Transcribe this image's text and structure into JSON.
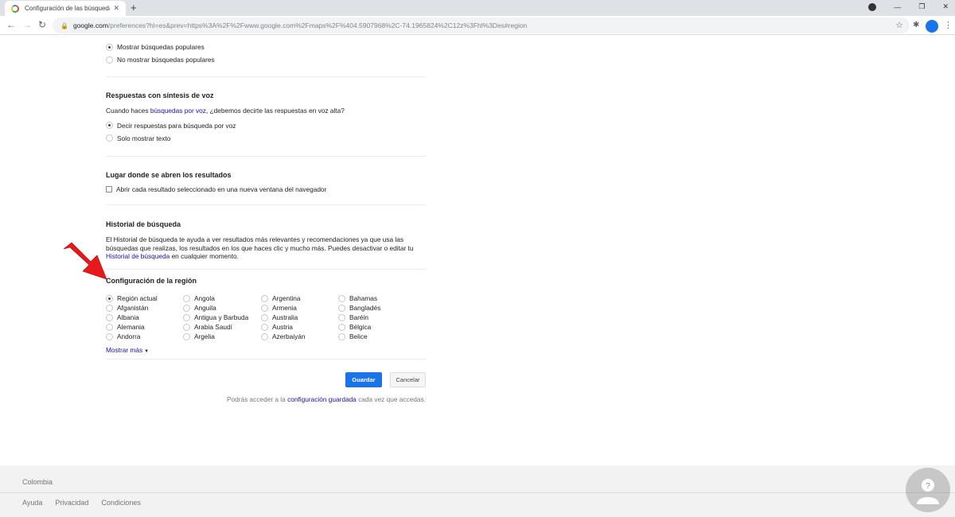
{
  "browser": {
    "tab_title": "Configuración de las búsquedas",
    "url_host": "google.com",
    "url_path": "/preferences?hl=es&prev=https%3A%2F%2Fwww.google.com%2Fmaps%2F%404.5907968%2C-74.1965824%2C12z%3Fhl%3Des#region"
  },
  "popular": {
    "options": [
      "Mostrar búsquedas populares",
      "No mostrar búsquedas populares"
    ],
    "selected_index": 0
  },
  "voice": {
    "title": "Respuestas con síntesis de voz",
    "question_prefix": "Cuando haces ",
    "question_link": "búsquedas por voz",
    "question_suffix": ", ¿debemos decirte las respuestas en voz alta?",
    "options": [
      "Decir respuestas para búsqueda por voz",
      "Solo mostrar texto"
    ],
    "selected_index": 0
  },
  "results_location": {
    "title": "Lugar donde se abren los resultados",
    "checkbox_label": "Abrir cada resultado seleccionado en una nueva ventana del navegador",
    "checked": false
  },
  "history": {
    "title": "Historial de búsqueda",
    "text": "El Historial de búsqueda te ayuda a ver resultados más relevantes y recomendaciones ya que usa las búsquedas que realizas, los resultados en los que haces clic y mucho más. Puedes desactivar o editar tu ",
    "link": "Historial de búsqueda",
    "suffix": " en cualquier momento."
  },
  "region": {
    "title": "Configuración de la región",
    "columns": [
      [
        "Región actual",
        "Afganistán",
        "Albania",
        "Alemania",
        "Andorra"
      ],
      [
        "Angola",
        "Anguila",
        "Antigua y Barbuda",
        "Arabia Saudí",
        "Argelia"
      ],
      [
        "Argentina",
        "Armenia",
        "Australia",
        "Austria",
        "Azerbaiyán"
      ],
      [
        "Bahamas",
        "Bangladés",
        "Baréin",
        "Bélgica",
        "Belice"
      ]
    ],
    "selected": "Región actual",
    "show_more": "Mostrar más"
  },
  "actions": {
    "save_label": "Guardar",
    "cancel_label": "Cancelar",
    "note_prefix": "Podrás acceder a la ",
    "note_link": "configuración guardada",
    "note_suffix": " cada vez que accedas."
  },
  "footer": {
    "country": "Colombia",
    "links": [
      "Ayuda",
      "Privacidad",
      "Condiciones"
    ]
  },
  "colors": {
    "link": "#1a0dab",
    "primary_button": "#1a73e8",
    "arrow": "#e8191c"
  }
}
